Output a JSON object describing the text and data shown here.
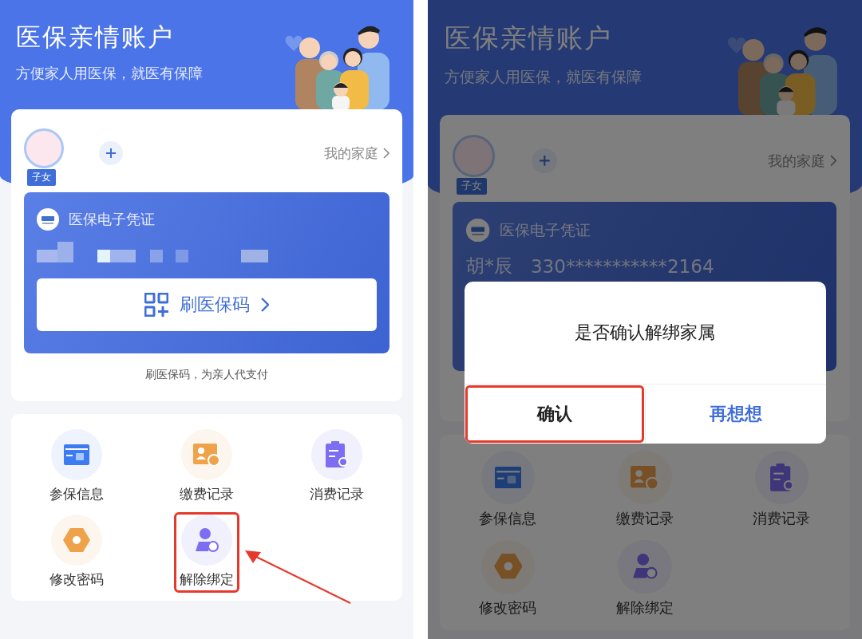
{
  "screens": [
    {
      "header": {
        "title": "医保亲情账户",
        "subtitle": "方便家人用医保，就医有保障"
      },
      "family": {
        "member_tag": "子女",
        "my_family": "我的家庭"
      },
      "card": {
        "title": "医保电子凭证",
        "masked": true,
        "button": "刷医保码"
      },
      "card_caption": "刷医保码，为亲人代支付",
      "annotation_arrow": true,
      "services": [
        {
          "label": "参保信息",
          "kind": "insurance",
          "highlighted": false
        },
        {
          "label": "缴费记录",
          "kind": "payment",
          "highlighted": false
        },
        {
          "label": "消费记录",
          "kind": "spending",
          "highlighted": false
        },
        {
          "label": "修改密码",
          "kind": "password",
          "highlighted": false
        },
        {
          "label": "解除绑定",
          "kind": "unbind",
          "highlighted": true
        }
      ]
    },
    {
      "dimmed": true,
      "header": {
        "title": "医保亲情账户",
        "subtitle": "方便家人用医保，就医有保障"
      },
      "family": {
        "member_tag": "子女",
        "my_family": "我的家庭"
      },
      "card": {
        "title": "医保电子凭证",
        "holder_name": "胡*辰",
        "id_number": "330***********2164"
      },
      "services": [
        {
          "label": "参保信息",
          "kind": "insurance",
          "highlighted": false
        },
        {
          "label": "缴费记录",
          "kind": "payment",
          "highlighted": false
        },
        {
          "label": "消费记录",
          "kind": "spending",
          "highlighted": false
        },
        {
          "label": "修改密码",
          "kind": "password",
          "highlighted": false
        },
        {
          "label": "解除绑定",
          "kind": "unbind",
          "highlighted": false
        }
      ],
      "dialog": {
        "message": "是否确认解绑家属",
        "buttons": [
          {
            "label": "确认",
            "kind": "confirm",
            "highlighted": true
          },
          {
            "label": "再想想",
            "kind": "cancel",
            "highlighted": false
          }
        ]
      }
    }
  ]
}
